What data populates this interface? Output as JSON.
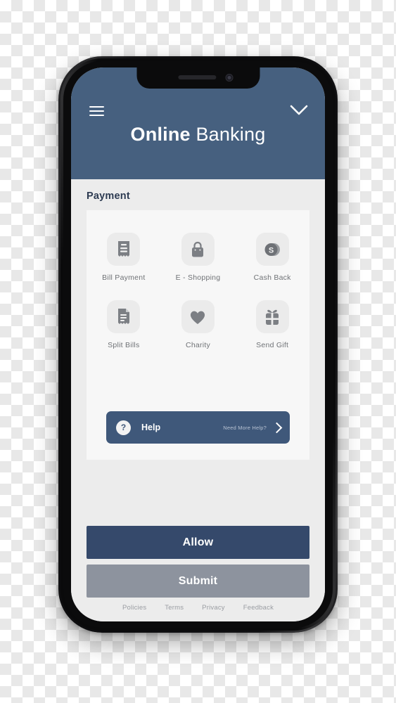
{
  "header": {
    "title_bold": "Online",
    "title_light": "Banking",
    "menu_icon": "hamburger-menu-icon",
    "collapse_icon": "chevron-down-icon",
    "background_color": "#46607f"
  },
  "main": {
    "section_title": "Payment",
    "tiles": [
      {
        "label": "Bill Payment",
        "icon": "receipt-icon"
      },
      {
        "label": "E - Shopping",
        "icon": "shopping-bag-icon"
      },
      {
        "label": "Cash Back",
        "icon": "coin-dollar-icon"
      },
      {
        "label": "Split Bills",
        "icon": "split-receipt-icon"
      },
      {
        "label": "Charity",
        "icon": "heart-icon"
      },
      {
        "label": "Send Gift",
        "icon": "gift-box-icon"
      }
    ],
    "help": {
      "badge": "?",
      "label": "Help",
      "sub_label": "Need More Help?",
      "arrow_icon": "chevron-right-icon",
      "background_color": "#3f587a"
    }
  },
  "actions": {
    "primary_label": "Allow",
    "primary_color": "#35496b",
    "secondary_label": "Submit",
    "secondary_color": "#8d939e"
  },
  "footer": {
    "links": [
      "Policies",
      "Terms",
      "Privacy",
      "Feedback"
    ]
  }
}
